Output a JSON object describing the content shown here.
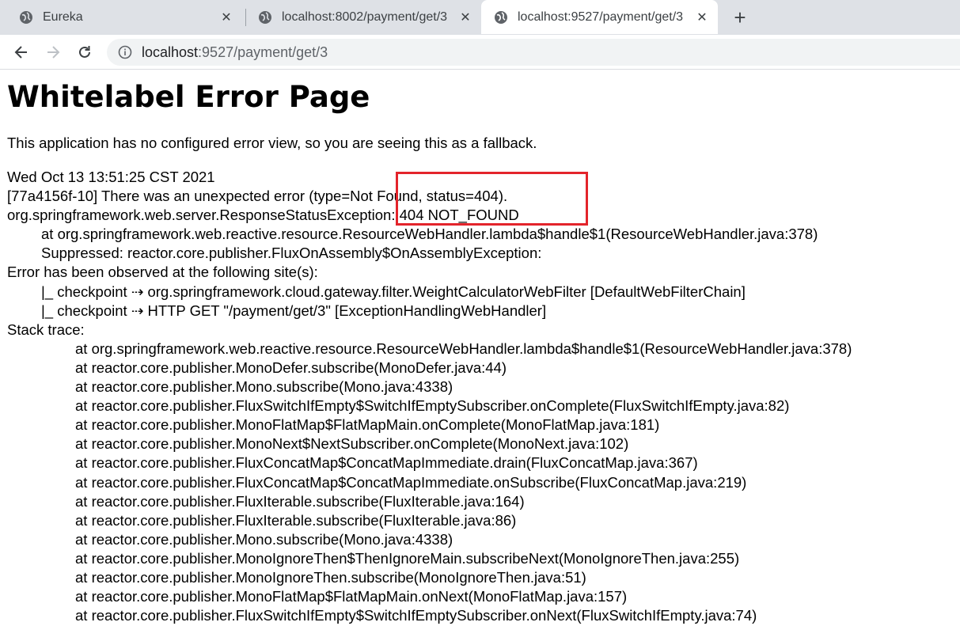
{
  "browser": {
    "tabs": [
      {
        "title": "Eureka",
        "active": false
      },
      {
        "title": "localhost:8002/payment/get/3",
        "active": false
      },
      {
        "title": "localhost:9527/payment/get/3",
        "active": true
      }
    ],
    "new_tab_symbol": "+",
    "close_symbol": "✕",
    "nav": {
      "back_icon": "back-arrow-icon",
      "forward_icon": "forward-arrow-icon",
      "reload_icon": "reload-icon"
    },
    "address": {
      "host": "localhost",
      "rest": ":9527/payment/get/3"
    }
  },
  "page": {
    "title": "Whitelabel Error Page",
    "intro": "This application has no configured error view, so you are seeing this as a fallback.",
    "timestamp": "Wed Oct 13 13:51:25 CST 2021",
    "error_line": "[77a4156f-10] There was an unexpected error (type=Not Found, status=404).",
    "exception_line": "org.springframework.web.server.ResponseStatusException: 404 NOT_FOUND",
    "at_line": "at org.springframework.web.reactive.resource.ResourceWebHandler.lambda$handle$1(ResourceWebHandler.java:378)",
    "suppressed_line": "Suppressed: reactor.core.publisher.FluxOnAssembly$OnAssemblyException:",
    "observed_header": "Error has been observed at the following site(s):",
    "checkpoints": [
      "|_ checkpoint ⇢ org.springframework.cloud.gateway.filter.WeightCalculatorWebFilter [DefaultWebFilterChain]",
      "|_ checkpoint ⇢ HTTP GET \"/payment/get/3\" [ExceptionHandlingWebHandler]"
    ],
    "stack_header": "Stack trace:",
    "stack": [
      "at org.springframework.web.reactive.resource.ResourceWebHandler.lambda$handle$1(ResourceWebHandler.java:378)",
      "at reactor.core.publisher.MonoDefer.subscribe(MonoDefer.java:44)",
      "at reactor.core.publisher.Mono.subscribe(Mono.java:4338)",
      "at reactor.core.publisher.FluxSwitchIfEmpty$SwitchIfEmptySubscriber.onComplete(FluxSwitchIfEmpty.java:82)",
      "at reactor.core.publisher.MonoFlatMap$FlatMapMain.onComplete(MonoFlatMap.java:181)",
      "at reactor.core.publisher.MonoNext$NextSubscriber.onComplete(MonoNext.java:102)",
      "at reactor.core.publisher.FluxConcatMap$ConcatMapImmediate.drain(FluxConcatMap.java:367)",
      "at reactor.core.publisher.FluxConcatMap$ConcatMapImmediate.onSubscribe(FluxConcatMap.java:219)",
      "at reactor.core.publisher.FluxIterable.subscribe(FluxIterable.java:164)",
      "at reactor.core.publisher.FluxIterable.subscribe(FluxIterable.java:86)",
      "at reactor.core.publisher.Mono.subscribe(Mono.java:4338)",
      "at reactor.core.publisher.MonoIgnoreThen$ThenIgnoreMain.subscribeNext(MonoIgnoreThen.java:255)",
      "at reactor.core.publisher.MonoIgnoreThen.subscribe(MonoIgnoreThen.java:51)",
      "at reactor.core.publisher.MonoFlatMap$FlatMapMain.onNext(MonoFlatMap.java:157)",
      "at reactor.core.publisher.FluxSwitchIfEmpty$SwitchIfEmptySubscriber.onNext(FluxSwitchIfEmpty.java:74)"
    ]
  },
  "colors": {
    "tabstrip": "#dee1e6",
    "highlight_box": "#e3242b",
    "omnibox": "#f1f3f4"
  }
}
